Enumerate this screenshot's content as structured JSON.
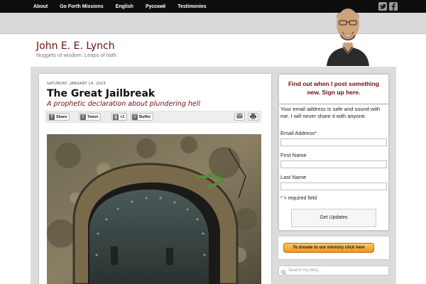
{
  "nav": {
    "items": [
      "About",
      "Go Forth Missions",
      "English",
      "Русский",
      "Testimonies"
    ]
  },
  "social": {
    "twitter_icon": "twitter-icon",
    "facebook_icon": "facebook-icon"
  },
  "header": {
    "site_title": "John E. E. Lynch",
    "tagline": "Nuggets of wisdom. Leaps of faith."
  },
  "post": {
    "date": "SATURDAY, JANUARY 14, 2023",
    "title": "The Great Jailbreak",
    "subtitle": "A prophetic declaration about plundering hell",
    "share": {
      "share_label": "Share",
      "tweet_label": "Tweet",
      "plusone_label": "+1",
      "buffer_label": "Buffer"
    }
  },
  "sidebar": {
    "signup": {
      "title": "Find out when I post something new. Sign up here.",
      "note": "Your email address is safe and sound with me. I will never share it with anyone.",
      "email_label": "Email Address*",
      "first_name_label": "First Name",
      "last_name_label": "Last Name",
      "required_note": "* = required field",
      "submit_label": "Get Updates"
    },
    "donate_label": "To donate to our ministry click here",
    "search_placeholder": "Search my blog..."
  },
  "colors": {
    "accent": "#6d0d0d",
    "nav_bg": "#0d0d0d",
    "donate": "#f0961a"
  }
}
